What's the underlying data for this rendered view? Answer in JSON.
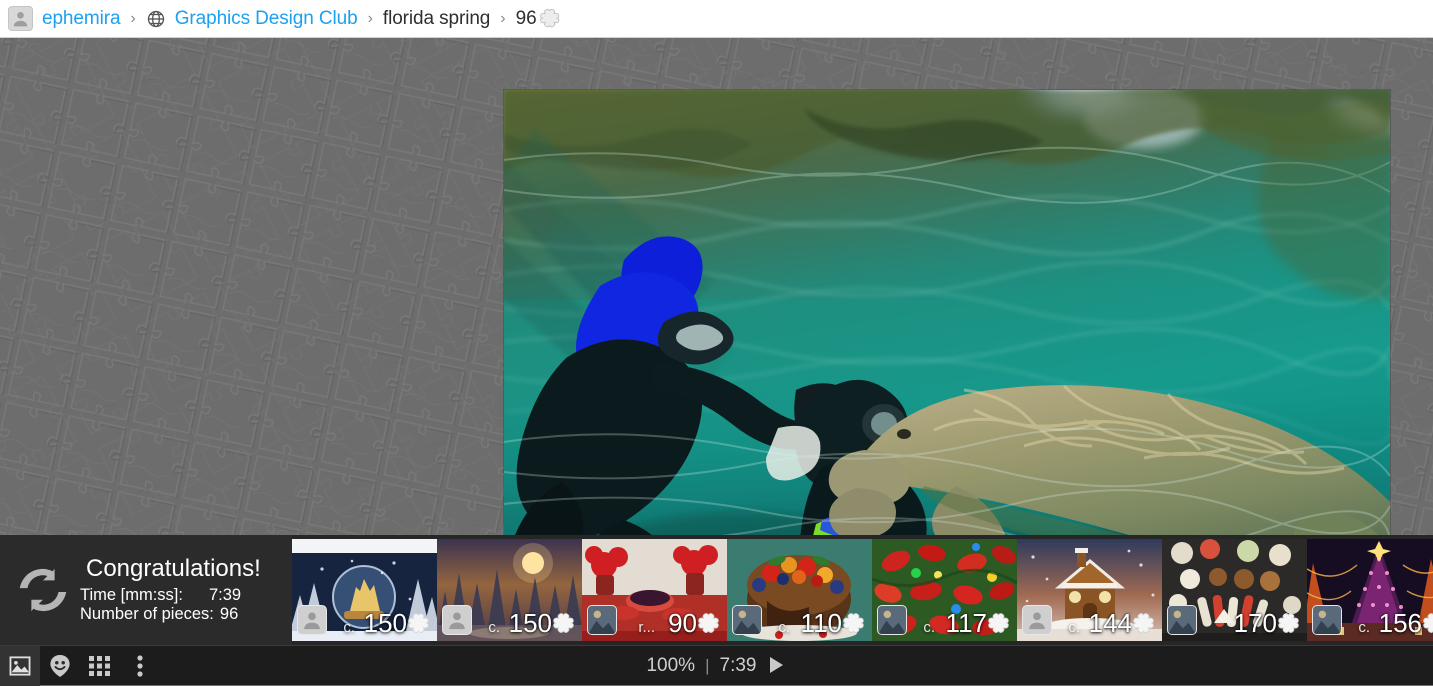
{
  "breadcrumb": {
    "user": "ephemira",
    "user_icon": "avatar-icon",
    "group": "Graphics Design Club",
    "group_icon": "globe-icon",
    "puzzle_name": "florida spring",
    "piece_count": "96",
    "piece_icon": "puzzle-piece-icon",
    "separator": "›"
  },
  "main_image": {
    "alt": "underwater photo of two scuba divers and a manatee in a florida spring",
    "width": "886",
    "height": "487"
  },
  "congrats": {
    "icon": "restart-icon",
    "title": "Congratulations!",
    "time_label": "Time [mm:ss]:",
    "time_value": "7:39",
    "pieces_label": "Number of pieces:",
    "pieces_value": "96"
  },
  "thumbnails": [
    {
      "prefix": "c.",
      "count": "150",
      "owner_icon": "avatar-icon",
      "piece_icon": "puzzle-piece-icon",
      "art": "snowglobe"
    },
    {
      "prefix": "c.",
      "count": "150",
      "owner_icon": "avatar-icon",
      "piece_icon": "puzzle-piece-icon",
      "art": "winter-forest-moon"
    },
    {
      "prefix": "r...",
      "count": "90",
      "owner_icon": "photo-avatar",
      "piece_icon": "puzzle-piece-icon",
      "art": "red-berry-table"
    },
    {
      "prefix": "c.",
      "count": "110",
      "owner_icon": "photo-avatar",
      "piece_icon": "puzzle-piece-icon",
      "art": "fruit-cake"
    },
    {
      "prefix": "c.",
      "count": "117",
      "owner_icon": "photo-avatar",
      "piece_icon": "puzzle-piece-icon",
      "art": "christmas-lights"
    },
    {
      "prefix": "c.",
      "count": "144",
      "owner_icon": "avatar-icon",
      "piece_icon": "puzzle-piece-icon",
      "art": "gingerbread-house"
    },
    {
      "prefix": "",
      "count": "170",
      "owner_icon": "photo-avatar",
      "piece_icon": "puzzle-piece-icon",
      "art": "cookie-platter"
    },
    {
      "prefix": "c.",
      "count": "156",
      "owner_icon": "photo-avatar",
      "piece_icon": "puzzle-piece-icon",
      "art": "christmas-tree-lights"
    }
  ],
  "status_bar": {
    "buttons": [
      {
        "name": "image-preview-icon",
        "active": true
      },
      {
        "name": "ghost-helper-icon",
        "active": false
      },
      {
        "name": "grid-sort-icon",
        "active": false
      },
      {
        "name": "more-options-icon",
        "active": false
      }
    ],
    "zoom": "100%",
    "divider": "|",
    "timer": "7:39",
    "play_icon": "play-icon"
  },
  "colors": {
    "link": "#1ba1f2",
    "breadcrumb_bg": "#ffffff",
    "board_bg": "#6d6d6d",
    "strip_bg": "#262626",
    "status_bg": "#1c1c1c",
    "text_light": "#cfcfcf"
  }
}
